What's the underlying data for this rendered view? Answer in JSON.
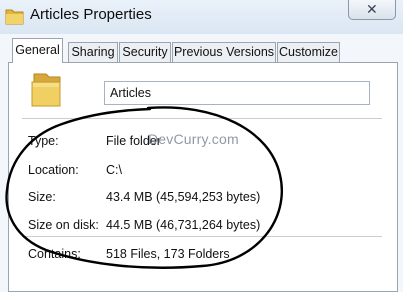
{
  "window": {
    "title": "Articles Properties",
    "close_glyph": "✕"
  },
  "tabs": [
    "General",
    "Sharing",
    "Security",
    "Previous Versions",
    "Customize"
  ],
  "active_tab": "General",
  "general": {
    "name_value": "Articles",
    "rows": [
      {
        "label": "Type:",
        "value": "File folder"
      },
      {
        "label": "Location:",
        "value": "C:\\"
      },
      {
        "label": "Size:",
        "value": "43.4 MB (45,594,253 bytes)"
      },
      {
        "label": "Size on disk:",
        "value": "44.5 MB (46,731,264 bytes)"
      },
      {
        "label": "Contains:",
        "value": "518 Files, 173 Folders"
      }
    ]
  },
  "watermark": "DevCurry.com",
  "icons": {
    "title": "folder-icon",
    "large": "folder-icon",
    "close": "close-icon"
  },
  "colors": {
    "folder": "#e8c24a",
    "annotation": "#000000"
  }
}
